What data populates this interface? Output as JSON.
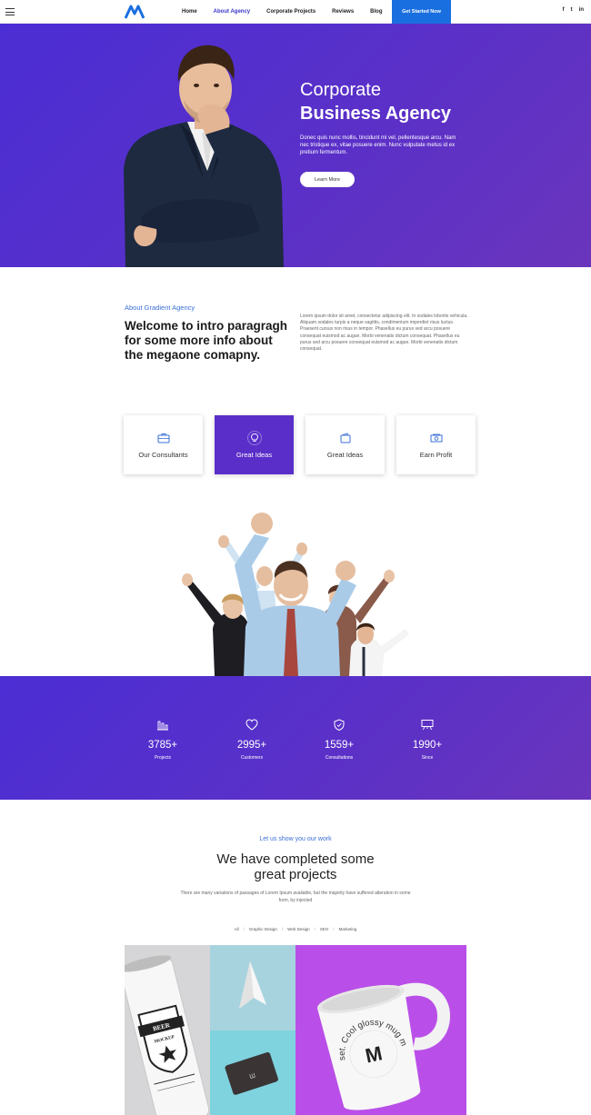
{
  "nav": {
    "links": [
      "Home",
      "About Agency",
      "Corporate Projects",
      "Reviews",
      "Blog"
    ],
    "cta": "Get Started Now",
    "social": [
      "f",
      "t",
      "in"
    ]
  },
  "hero": {
    "title_line1": "Corporate",
    "title_line2": "Business Agency",
    "text": "Donec quis nunc mollis, tincidunt mi vel, pellentesque arcu. Nam nec tristique ex, vitae posuere enim. Nunc vulputate metus id ex pretium fermentum.",
    "button": "Learn More"
  },
  "about": {
    "kicker": "About Gradient Agency",
    "title": "Welcome to intro paragragh for some more info about the megaone comapny.",
    "text": "Lorem ipsum dolor sit amet, consectetur adipiscing elit. In sodales lobortis vehicula. Aliquam sodales turpis a neque sagittis, condimentum imperdiet risus luctus. Praesent cursus non risus in tempor. Phasellus eu purus sed arcu posuere consequat euismod ac augue. Morbi venenatis dictum consequat. Phasellus eu purus sed arcu posuere consequat euismod ac augue. Morbi venenatis dictum consequat."
  },
  "features": [
    {
      "label": "Our Consultants",
      "icon": "briefcase-icon"
    },
    {
      "label": "Great Ideas",
      "icon": "lightbulb-icon"
    },
    {
      "label": "Great Ideas",
      "icon": "wallet-icon"
    },
    {
      "label": "Earn Profit",
      "icon": "money-icon"
    }
  ],
  "stats": [
    {
      "value": "3785+",
      "label": "Projects",
      "icon": "bar-chart-icon"
    },
    {
      "value": "2995+",
      "label": "Customers",
      "icon": "heart-icon"
    },
    {
      "value": "1559+",
      "label": "Consultations",
      "icon": "shield-icon"
    },
    {
      "value": "1990+",
      "label": "Since",
      "icon": "presentation-icon"
    }
  ],
  "work": {
    "kicker": "Let us show you our work",
    "title_line1": "We have completed some",
    "title_line2": "great projects",
    "text": "There are many variations of passages of Lorem Ipsum available, but the majority have suffered alteration in some form, by injected",
    "filters": [
      "All",
      "Graphic Design",
      "Web Design",
      "SEO",
      "Marketing"
    ]
  },
  "portfolio": {
    "can_label_1": "BEER",
    "can_label_2": "MOCKUP",
    "mug_text": "set. Cool glossy mug mock-up",
    "mug_letter": "M"
  },
  "colors": {
    "brand_purple": "#5a30c8",
    "accent_blue": "#1a6fe0",
    "kicker_blue": "#3a6fd8"
  }
}
